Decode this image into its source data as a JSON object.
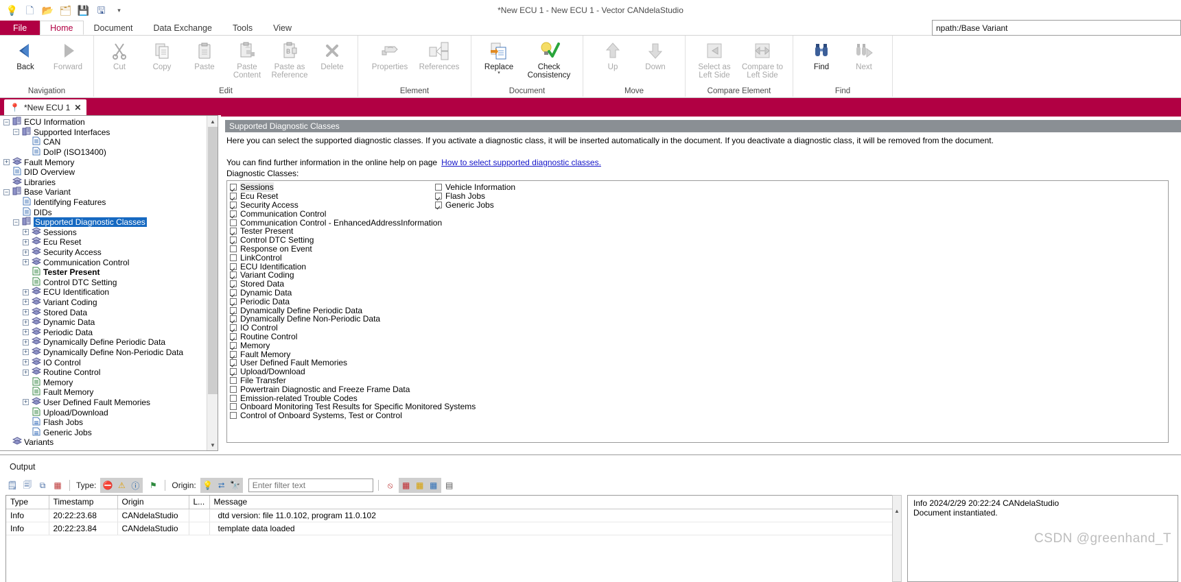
{
  "window": {
    "title": "*New ECU 1 - New ECU 1 - Vector CANdelaStudio"
  },
  "quick_access": [
    {
      "name": "lightbulb",
      "glyph": "💡"
    },
    {
      "name": "new-document",
      "glyph": "📄"
    },
    {
      "name": "open-folder",
      "glyph": "📂"
    },
    {
      "name": "open-template",
      "glyph": "📝"
    },
    {
      "name": "save",
      "glyph": "💾"
    },
    {
      "name": "save-as",
      "glyph": "🖫"
    },
    {
      "name": "customize-dropdown",
      "glyph": "─"
    }
  ],
  "ribbon": {
    "tabs": [
      {
        "label": "File",
        "active": false,
        "file": true
      },
      {
        "label": "Home",
        "active": true,
        "file": false
      },
      {
        "label": "Document",
        "active": false,
        "file": false
      },
      {
        "label": "Data Exchange",
        "active": false,
        "file": false
      },
      {
        "label": "Tools",
        "active": false,
        "file": false
      },
      {
        "label": "View",
        "active": false,
        "file": false
      }
    ],
    "groups": [
      {
        "title": "Navigation",
        "items": [
          {
            "label": "Back",
            "icon": "back-arrow-icon",
            "disabled": false
          },
          {
            "label": "Forward",
            "icon": "forward-arrow-icon",
            "disabled": true
          }
        ]
      },
      {
        "title": "Edit",
        "items": [
          {
            "label": "Cut",
            "icon": "scissors-icon",
            "disabled": true
          },
          {
            "label": "Copy",
            "icon": "copy-icon",
            "disabled": true
          },
          {
            "label": "Paste",
            "icon": "paste-icon",
            "disabled": true
          },
          {
            "label": "Paste Content",
            "icon": "paste-content-icon",
            "disabled": true
          },
          {
            "label": "Paste as Reference",
            "icon": "paste-as-reference-icon",
            "disabled": true
          },
          {
            "label": "Delete",
            "icon": "delete-x-icon",
            "disabled": true
          }
        ]
      },
      {
        "title": "Element",
        "items": [
          {
            "label": "Properties",
            "icon": "properties-icon",
            "disabled": true
          },
          {
            "label": "References",
            "icon": "references-icon",
            "disabled": true
          }
        ]
      },
      {
        "title": "Document",
        "items": [
          {
            "label": "Replace",
            "icon": "replace-icon",
            "disabled": false,
            "dropdown": true
          },
          {
            "label": "Check Consistency",
            "icon": "check-consistency-icon",
            "disabled": false
          }
        ]
      },
      {
        "title": "Move",
        "items": [
          {
            "label": "Up",
            "icon": "arrow-up-icon",
            "disabled": true
          },
          {
            "label": "Down",
            "icon": "arrow-down-icon",
            "disabled": true
          }
        ]
      },
      {
        "title": "Compare Element",
        "items": [
          {
            "label": "Select as Left Side",
            "icon": "select-left-side-icon",
            "disabled": true
          },
          {
            "label": "Compare to Left Side",
            "icon": "compare-left-side-icon",
            "disabled": true
          }
        ]
      },
      {
        "title": "Find",
        "items": [
          {
            "label": "Find",
            "icon": "binoculars-icon",
            "disabled": false
          },
          {
            "label": "Next",
            "icon": "find-next-icon",
            "disabled": true
          }
        ]
      }
    ]
  },
  "path_field": {
    "value": "npath:/Base Variant"
  },
  "document_tab": {
    "label": "*New ECU 1",
    "pin_icon": "pin-icon",
    "close_icon": "close-icon"
  },
  "tree": {
    "nodes": [
      {
        "label": "ECU Information",
        "depth": 0,
        "toggle": "minus",
        "icon": "book-icon",
        "selected": false,
        "bold": false
      },
      {
        "label": "Supported Interfaces",
        "depth": 1,
        "toggle": "minus",
        "icon": "book-icon",
        "selected": false,
        "bold": false
      },
      {
        "label": "CAN",
        "depth": 2,
        "toggle": "leaf",
        "icon": "page-blue-icon",
        "selected": false,
        "bold": false
      },
      {
        "label": "DoIP (ISO13400)",
        "depth": 2,
        "toggle": "leaf",
        "icon": "page-blue-icon",
        "selected": false,
        "bold": false
      },
      {
        "label": "Fault Memory",
        "depth": 0,
        "toggle": "plus",
        "icon": "stack-icon",
        "selected": false,
        "bold": false
      },
      {
        "label": "DID Overview",
        "depth": 0,
        "toggle": "leaf",
        "icon": "page-blue-icon",
        "selected": false,
        "bold": false
      },
      {
        "label": "Libraries",
        "depth": 0,
        "toggle": "leaf",
        "icon": "stack-icon",
        "selected": false,
        "bold": false
      },
      {
        "label": "Base Variant",
        "depth": 0,
        "toggle": "minus",
        "icon": "book-icon",
        "selected": false,
        "bold": false
      },
      {
        "label": "Identifying Features",
        "depth": 1,
        "toggle": "leaf",
        "icon": "page-blue-icon",
        "selected": false,
        "bold": false
      },
      {
        "label": "DIDs",
        "depth": 1,
        "toggle": "leaf",
        "icon": "page-blue-icon",
        "selected": false,
        "bold": false
      },
      {
        "label": "Supported Diagnostic Classes",
        "depth": 1,
        "toggle": "minus",
        "icon": "book-icon",
        "selected": true,
        "bold": false
      },
      {
        "label": "Sessions",
        "depth": 2,
        "toggle": "plus",
        "icon": "stack-icon",
        "selected": false,
        "bold": false
      },
      {
        "label": "Ecu Reset",
        "depth": 2,
        "toggle": "plus",
        "icon": "stack-icon",
        "selected": false,
        "bold": false
      },
      {
        "label": "Security Access",
        "depth": 2,
        "toggle": "plus",
        "icon": "stack-icon",
        "selected": false,
        "bold": false
      },
      {
        "label": "Communication Control",
        "depth": 2,
        "toggle": "plus",
        "icon": "stack-icon",
        "selected": false,
        "bold": false
      },
      {
        "label": "Tester Present",
        "depth": 2,
        "toggle": "leaf",
        "icon": "page-green-icon",
        "selected": false,
        "bold": true
      },
      {
        "label": "Control DTC Setting",
        "depth": 2,
        "toggle": "leaf",
        "icon": "page-green-icon",
        "selected": false,
        "bold": false
      },
      {
        "label": "ECU Identification",
        "depth": 2,
        "toggle": "plus",
        "icon": "stack-icon",
        "selected": false,
        "bold": false
      },
      {
        "label": "Variant Coding",
        "depth": 2,
        "toggle": "plus",
        "icon": "stack-icon",
        "selected": false,
        "bold": false
      },
      {
        "label": "Stored Data",
        "depth": 2,
        "toggle": "plus",
        "icon": "stack-icon",
        "selected": false,
        "bold": false
      },
      {
        "label": "Dynamic Data",
        "depth": 2,
        "toggle": "plus",
        "icon": "stack-icon",
        "selected": false,
        "bold": false
      },
      {
        "label": "Periodic Data",
        "depth": 2,
        "toggle": "plus",
        "icon": "stack-icon",
        "selected": false,
        "bold": false
      },
      {
        "label": "Dynamically Define Periodic Data",
        "depth": 2,
        "toggle": "plus",
        "icon": "stack-icon",
        "selected": false,
        "bold": false
      },
      {
        "label": "Dynamically Define Non-Periodic Data",
        "depth": 2,
        "toggle": "plus",
        "icon": "stack-icon",
        "selected": false,
        "bold": false
      },
      {
        "label": "IO Control",
        "depth": 2,
        "toggle": "plus",
        "icon": "stack-icon",
        "selected": false,
        "bold": false
      },
      {
        "label": "Routine Control",
        "depth": 2,
        "toggle": "plus",
        "icon": "stack-icon",
        "selected": false,
        "bold": false
      },
      {
        "label": "Memory",
        "depth": 2,
        "toggle": "leaf",
        "icon": "page-green-icon",
        "selected": false,
        "bold": false
      },
      {
        "label": "Fault Memory",
        "depth": 2,
        "toggle": "leaf",
        "icon": "page-green-icon",
        "selected": false,
        "bold": false
      },
      {
        "label": "User Defined Fault Memories",
        "depth": 2,
        "toggle": "plus",
        "icon": "stack-icon",
        "selected": false,
        "bold": false
      },
      {
        "label": "Upload/Download",
        "depth": 2,
        "toggle": "leaf",
        "icon": "page-green-icon",
        "selected": false,
        "bold": false
      },
      {
        "label": "Flash Jobs",
        "depth": 2,
        "toggle": "leaf",
        "icon": "job-icon",
        "selected": false,
        "bold": false
      },
      {
        "label": "Generic Jobs",
        "depth": 2,
        "toggle": "leaf",
        "icon": "job-icon",
        "selected": false,
        "bold": false
      },
      {
        "label": "Variants",
        "depth": 0,
        "toggle": "leaf",
        "icon": "stack-icon",
        "selected": false,
        "bold": false
      }
    ]
  },
  "content": {
    "header": "Supported Diagnostic Classes",
    "intro": "Here you can select the supported diagnostic classes. If you activate a diagnostic class, it will be inserted automatically in the document. If you deactivate a diagnostic class, it will be removed from the document.",
    "help_prefix": "You can find further information in the online help on page",
    "help_link": "How to select supported diagnostic classes.",
    "list_label": "Diagnostic Classes:",
    "classes_left": [
      {
        "label": "Sessions",
        "checked": true,
        "highlight": true
      },
      {
        "label": "Ecu Reset",
        "checked": true,
        "highlight": false
      },
      {
        "label": "Security Access",
        "checked": true,
        "highlight": false
      },
      {
        "label": "Communication Control",
        "checked": true,
        "highlight": false
      },
      {
        "label": "Communication Control - EnhancedAddressInformation",
        "checked": false,
        "highlight": false
      },
      {
        "label": "Tester Present",
        "checked": true,
        "highlight": false
      },
      {
        "label": "Control DTC Setting",
        "checked": true,
        "highlight": false
      },
      {
        "label": "Response on Event",
        "checked": false,
        "highlight": false
      },
      {
        "label": "LinkControl",
        "checked": false,
        "highlight": false
      },
      {
        "label": "ECU Identification",
        "checked": true,
        "highlight": false
      },
      {
        "label": "Variant Coding",
        "checked": true,
        "highlight": false
      },
      {
        "label": "Stored Data",
        "checked": true,
        "highlight": false
      },
      {
        "label": "Dynamic Data",
        "checked": true,
        "highlight": false
      },
      {
        "label": "Periodic Data",
        "checked": true,
        "highlight": false
      },
      {
        "label": "Dynamically Define Periodic Data",
        "checked": true,
        "highlight": false
      },
      {
        "label": "Dynamically Define Non-Periodic Data",
        "checked": true,
        "highlight": false
      },
      {
        "label": "IO Control",
        "checked": true,
        "highlight": false
      },
      {
        "label": "Routine Control",
        "checked": true,
        "highlight": false
      },
      {
        "label": "Memory",
        "checked": true,
        "highlight": false
      },
      {
        "label": "Fault Memory",
        "checked": true,
        "highlight": false
      },
      {
        "label": "User Defined Fault Memories",
        "checked": true,
        "highlight": false
      },
      {
        "label": "Upload/Download",
        "checked": true,
        "highlight": false
      },
      {
        "label": "File Transfer",
        "checked": false,
        "highlight": false
      },
      {
        "label": "Powertrain Diagnostic and Freeze Frame Data",
        "checked": false,
        "highlight": false
      },
      {
        "label": "Emission-related Trouble Codes",
        "checked": false,
        "highlight": false
      },
      {
        "label": "Onboard Monitoring Test Results for Specific Monitored Systems",
        "checked": false,
        "highlight": false
      },
      {
        "label": "Control of Onboard Systems, Test or Control",
        "checked": false,
        "highlight": false
      }
    ],
    "classes_right": [
      {
        "label": "Vehicle Information",
        "checked": false,
        "highlight": false
      },
      {
        "label": "Flash Jobs",
        "checked": true,
        "highlight": false
      },
      {
        "label": "Generic Jobs",
        "checked": true,
        "highlight": false
      }
    ]
  },
  "output": {
    "title": "Output",
    "tools_left": [
      {
        "name": "copy-all-icon",
        "glyph": "☰"
      },
      {
        "name": "clear-timestamps-icon",
        "glyph": "☷"
      },
      {
        "name": "copy-icon",
        "glyph": "⧉"
      },
      {
        "name": "clear-output-icon",
        "glyph": "⌧"
      }
    ],
    "type_label": "Type:",
    "type_filters": [
      {
        "name": "error-filter-icon",
        "glyph": "✖",
        "color": "#c0272d"
      },
      {
        "name": "warning-filter-icon",
        "glyph": "⚠",
        "color": "#e0a008"
      },
      {
        "name": "info-filter-icon",
        "glyph": "ⓘ",
        "color": "#1b5fa8"
      },
      {
        "name": "flag-filter-icon",
        "glyph": "⚑",
        "color": "#2d8a3e"
      }
    ],
    "origin_label": "Origin:",
    "origin_filters": [
      {
        "name": "lightbulb-origin-icon",
        "glyph": "💡",
        "color": "#d9a300"
      },
      {
        "name": "exchange-origin-icon",
        "glyph": "⮂",
        "color": "#2e6fb7"
      },
      {
        "name": "find-origin-icon",
        "glyph": "🔭",
        "color": "#2e4f86"
      }
    ],
    "filter_placeholder": "Enter filter text",
    "tools_right": [
      {
        "name": "clear-filter-icon",
        "glyph": "⊘",
        "color": "#c0272d"
      },
      {
        "name": "columns-color-icon",
        "glyph": "▦",
        "color": "#c0272d"
      },
      {
        "name": "columns-icon",
        "glyph": "▦",
        "color": "#d8a000"
      },
      {
        "name": "autoscroll-icon",
        "glyph": "▦",
        "color": "#2e6fb7"
      },
      {
        "name": "split-view-icon",
        "glyph": "▧",
        "color": "#555555"
      }
    ],
    "columns": [
      "Type",
      "Timestamp",
      "Origin",
      "L...",
      "Message"
    ],
    "rows": [
      {
        "type": "Info",
        "timestamp": "20:22:23.68",
        "origin": "CANdelaStudio",
        "level": "",
        "message": "dtd version: file 11.0.102, program 11.0.102"
      },
      {
        "type": "Info",
        "timestamp": "20:22:23.84",
        "origin": "CANdelaStudio",
        "level": "",
        "message": "template data loaded"
      }
    ],
    "detail": {
      "line1": "Info  2024/2/29 20:22:24  CANdelaStudio",
      "line2": "Document instantiated."
    }
  },
  "watermark": "CSDN @greenhand_T"
}
